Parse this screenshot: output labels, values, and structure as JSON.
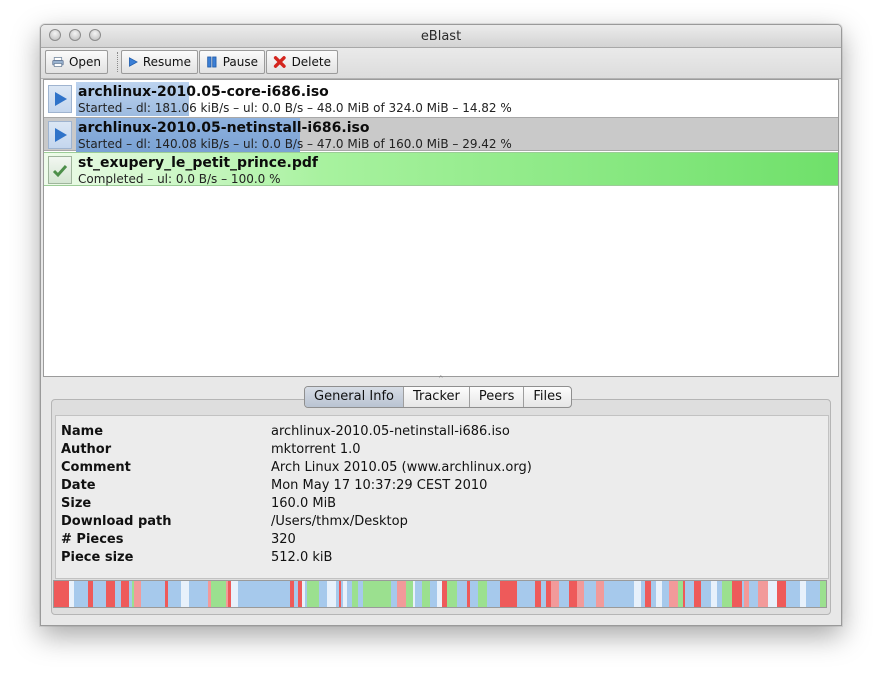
{
  "window": {
    "title": "eBlast"
  },
  "toolbar": {
    "open_label": "Open",
    "resume_label": "Resume",
    "pause_label": "Pause",
    "delete_label": "Delete"
  },
  "torrents": [
    {
      "name": "archlinux-2010.05-core-i686.iso",
      "status": "Started – dl: 181.06 kiB/s – ul: 0.0 B/s – 48.0 MiB of 324.0 MiB – 14.82 %",
      "progress": 0.1482,
      "state": "started",
      "selected": false
    },
    {
      "name": "archlinux-2010.05-netinstall-i686.iso",
      "status": "Started – dl: 140.08 kiB/s – ul: 0.0 B/s – 47.0 MiB of 160.0 MiB – 29.42 %",
      "progress": 0.2942,
      "state": "started",
      "selected": true
    },
    {
      "name": "st_exupery_le_petit_prince.pdf",
      "status": "Completed – ul: 0.0 B/s – 100.0 %",
      "progress": 1.0,
      "state": "completed",
      "selected": false
    }
  ],
  "tabs": [
    {
      "label": "General Info",
      "active": true
    },
    {
      "label": "Tracker",
      "active": false
    },
    {
      "label": "Peers",
      "active": false
    },
    {
      "label": "Files",
      "active": false
    }
  ],
  "general_info": [
    {
      "label": "Name",
      "value": "archlinux-2010.05-netinstall-i686.iso"
    },
    {
      "label": "Author",
      "value": "mktorrent 1.0"
    },
    {
      "label": "Comment",
      "value": "Arch Linux 2010.05 (www.archlinux.org)"
    },
    {
      "label": "Date",
      "value": "Mon May 17 10:37:29 CEST 2010"
    },
    {
      "label": "Size",
      "value": "160.0 MiB"
    },
    {
      "label": "Download path",
      "value": "/Users/thmx/Desktop"
    },
    {
      "label": "# Pieces",
      "value": "320"
    },
    {
      "label": "Piece size",
      "value": "512.0 kiB"
    }
  ],
  "colors": {
    "progress_blue": "#9dbbe0",
    "selected_row": "#c9c9c9",
    "completed_green": "#6fe06a",
    "piece_missing": "#a6c9ec",
    "piece_done": "#ee5a5a",
    "piece_partial": "#9be08f",
    "piece_light": "#e8f1fb"
  },
  "icons": {
    "open": "printer-icon",
    "resume": "play-icon",
    "pause": "pause-icon",
    "delete": "red-x-icon",
    "started": "play-icon",
    "completed": "checkmark-icon"
  }
}
